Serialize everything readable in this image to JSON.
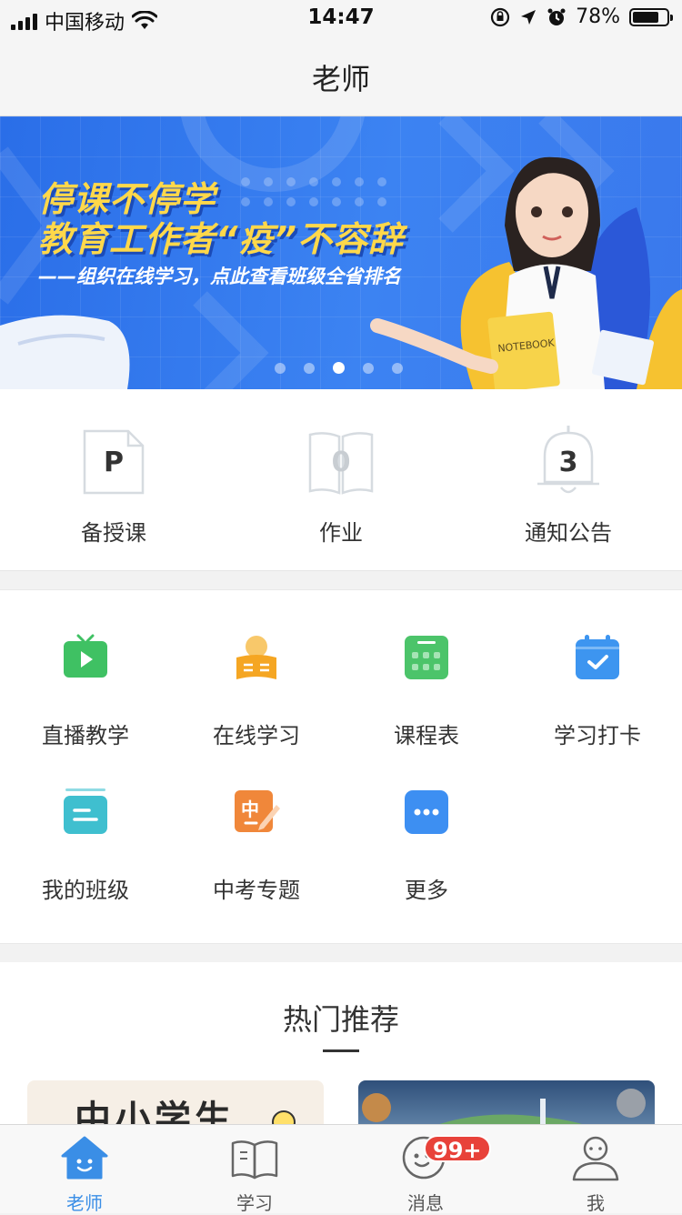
{
  "status_bar": {
    "carrier": "中国移动",
    "time": "14:47",
    "battery": "78%",
    "battery_level": 0.78
  },
  "nav": {
    "title": "老师"
  },
  "banner": {
    "line1": "停课不停学",
    "line2": "教育工作者“疫”不容辞",
    "line3": "——组织在线学习，点此查看班级全省排名",
    "notebook_label": "NOTEBOOK",
    "dots_count": 5,
    "active_dot": 2
  },
  "stats": [
    {
      "label": "备授课",
      "value": "P",
      "icon": "document-icon"
    },
    {
      "label": "作业",
      "value": "0",
      "icon": "book-icon"
    },
    {
      "label": "通知公告",
      "value": "3",
      "icon": "bell-icon"
    }
  ],
  "apps": [
    {
      "label": "直播教学",
      "icon": "tv-play-icon",
      "color": "#3fc163"
    },
    {
      "label": "在线学习",
      "icon": "reading-icon",
      "color": "#f5a623"
    },
    {
      "label": "课程表",
      "icon": "calendar-grid-icon",
      "color": "#4cc46a"
    },
    {
      "label": "学习打卡",
      "icon": "calendar-check-icon",
      "color": "#3d95f0"
    },
    {
      "label": "我的班级",
      "icon": "class-board-icon",
      "color": "#3fbfcf"
    },
    {
      "label": "中考专题",
      "icon": "exam-pen-icon",
      "color": "#f0873a"
    },
    {
      "label": "更多",
      "icon": "more-dots-icon",
      "color": "#3d8ff2"
    }
  ],
  "hot": {
    "title": "热门推荐",
    "card1_text": "中小学生"
  },
  "tabbar": {
    "tabs": [
      {
        "label": "老师",
        "icon": "home-icon"
      },
      {
        "label": "学习",
        "icon": "open-book-icon"
      },
      {
        "label": "消息",
        "icon": "message-face-icon"
      },
      {
        "label": "我",
        "icon": "person-icon"
      }
    ],
    "active": 0,
    "message_badge": "99+"
  },
  "colors": {
    "accent": "#3a8ee6",
    "badge": "#e8423a",
    "banner_yellow": "#ffd84a"
  }
}
